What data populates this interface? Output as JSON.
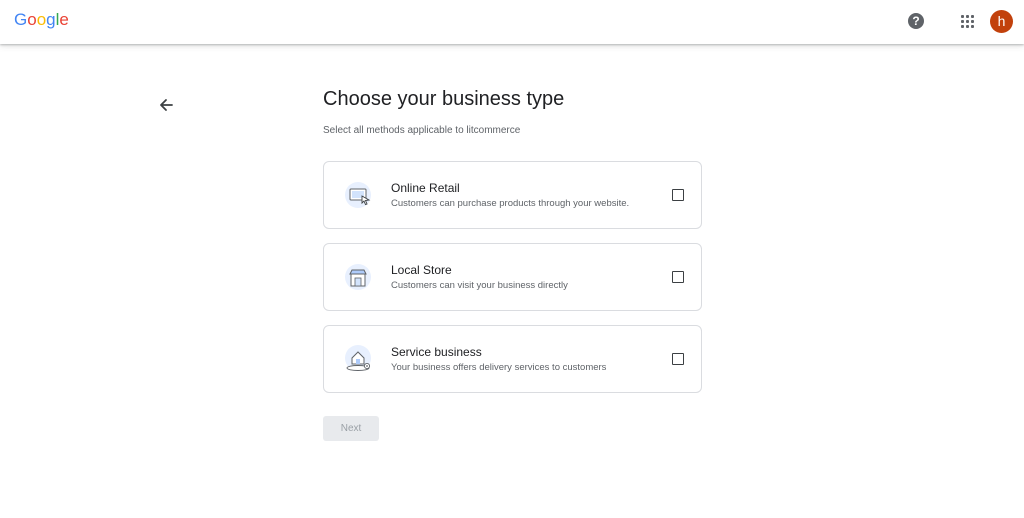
{
  "header": {
    "logo_letters": [
      "G",
      "o",
      "o",
      "g",
      "l",
      "e"
    ],
    "logo_colors": [
      "#4285F4",
      "#EA4335",
      "#FBBC05",
      "#4285F4",
      "#34A853",
      "#EA4335"
    ],
    "help_icon": "help-icon",
    "apps_icon": "apps-grid-icon",
    "avatar_letter": "h",
    "avatar_color": "#c2410c"
  },
  "page": {
    "back_icon": "arrow-back-icon",
    "title": "Choose your business type",
    "subtitle": "Select all methods applicable to litcommerce"
  },
  "options": [
    {
      "icon": "online-retail-icon",
      "title": "Online Retail",
      "description": "Customers can purchase products through your website.",
      "checked": false
    },
    {
      "icon": "local-store-icon",
      "title": "Local Store",
      "description": "Customers can visit your business directly",
      "checked": false
    },
    {
      "icon": "service-business-icon",
      "title": "Service business",
      "description": "Your business offers delivery services to customers",
      "checked": false
    }
  ],
  "actions": {
    "next_label": "Next",
    "next_enabled": false
  }
}
